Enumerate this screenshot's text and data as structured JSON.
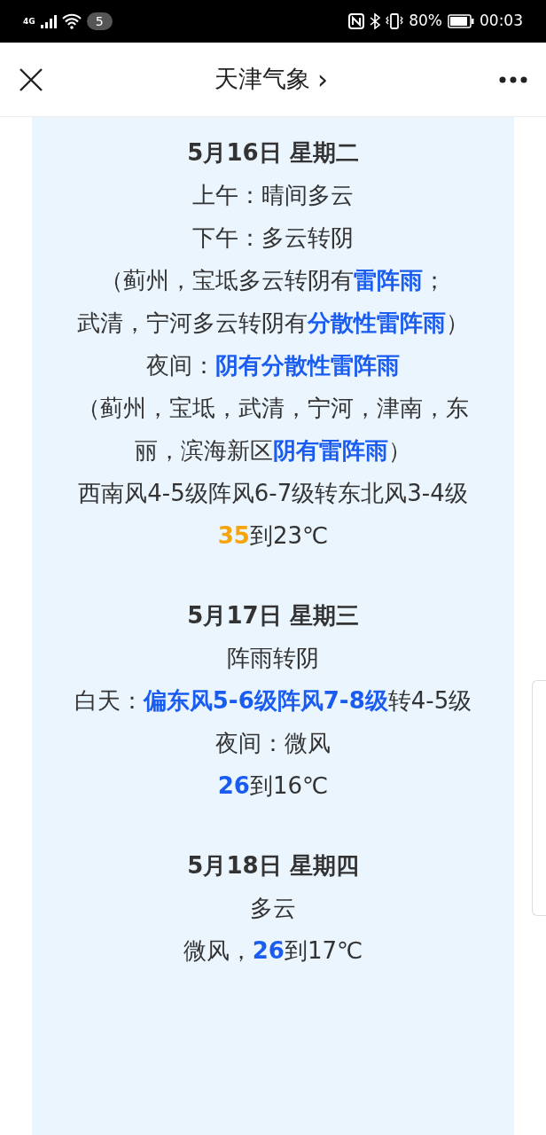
{
  "status_bar": {
    "network": "4G",
    "notification_count": "5",
    "battery": "80%",
    "time": "00:03"
  },
  "nav": {
    "title": "天津气象",
    "chevron": "›"
  },
  "days": [
    {
      "title": "5月16日 星期二",
      "lines": [
        [
          {
            "kind": "plain",
            "text": "上午：晴间多云"
          }
        ],
        [
          {
            "kind": "plain",
            "text": "下午：多云转阴"
          }
        ],
        [
          {
            "kind": "plain",
            "text": "（蓟州，宝坻多云转阴有"
          },
          {
            "kind": "blue",
            "text": "雷阵雨"
          },
          {
            "kind": "plain",
            "text": "；"
          }
        ],
        [
          {
            "kind": "plain",
            "text": "武清，宁河多云转阴有"
          },
          {
            "kind": "blue",
            "text": "分散性雷阵雨"
          },
          {
            "kind": "plain",
            "text": "）"
          }
        ],
        [
          {
            "kind": "plain",
            "text": "夜间："
          },
          {
            "kind": "blue",
            "text": "阴有分散性雷阵雨"
          }
        ],
        [
          {
            "kind": "plain",
            "text": "（蓟州，宝坻，武清，宁河，津南，东丽，滨海新区"
          },
          {
            "kind": "blue",
            "text": "阴有雷阵雨"
          },
          {
            "kind": "plain",
            "text": "）"
          }
        ],
        [
          {
            "kind": "plain",
            "text": "西南风4-5级阵风6-7级转东北风3-4级"
          }
        ],
        [
          {
            "kind": "orange",
            "text": "35"
          },
          {
            "kind": "plain",
            "text": "到23℃"
          }
        ]
      ]
    },
    {
      "title": "5月17日 星期三",
      "lines": [
        [
          {
            "kind": "plain",
            "text": "阵雨转阴"
          }
        ],
        [
          {
            "kind": "plain",
            "text": "白天："
          },
          {
            "kind": "blue",
            "text": "偏东风5-6级阵风7-8级"
          },
          {
            "kind": "plain",
            "text": "转4-5级"
          }
        ],
        [
          {
            "kind": "plain",
            "text": "夜间：微风"
          }
        ],
        [
          {
            "kind": "blue",
            "text": "26"
          },
          {
            "kind": "plain",
            "text": "到16℃"
          }
        ]
      ]
    },
    {
      "title": "5月18日 星期四",
      "lines": [
        [
          {
            "kind": "plain",
            "text": "多云"
          }
        ],
        [
          {
            "kind": "plain",
            "text": "微风，"
          },
          {
            "kind": "blue",
            "text": "26"
          },
          {
            "kind": "plain",
            "text": "到17℃"
          }
        ]
      ]
    }
  ]
}
